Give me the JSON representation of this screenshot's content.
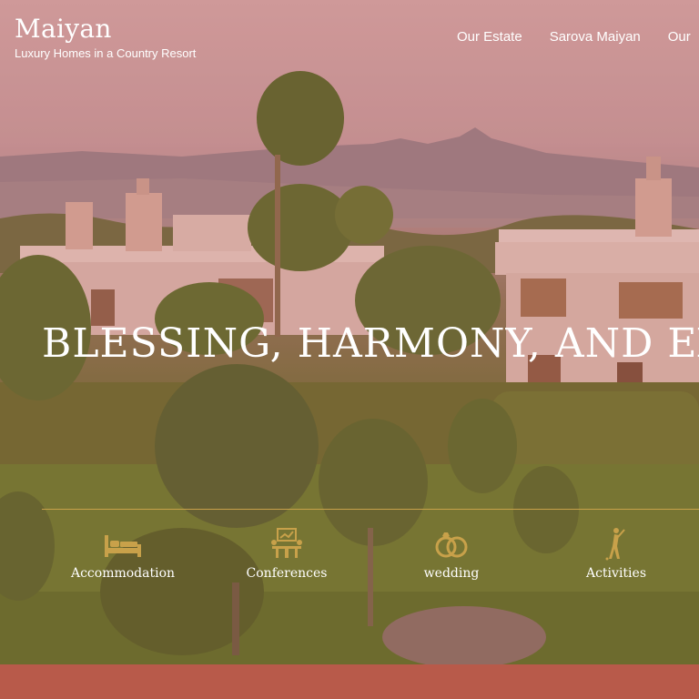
{
  "brand": {
    "title": "Maiyan",
    "tagline": "Luxury Homes in a Country Resort"
  },
  "nav": {
    "items": [
      "Our Estate",
      "Sarova Maiyan",
      "Our"
    ]
  },
  "hero": {
    "headline": "BLESSING, HARMONY, AND EX"
  },
  "features": [
    {
      "label": "Accommodation",
      "icon": "bed-icon"
    },
    {
      "label": "Conferences",
      "icon": "conference-icon"
    },
    {
      "label": "wedding",
      "icon": "wedding-rings-icon"
    },
    {
      "label": "Activities",
      "icon": "golfer-icon"
    }
  ],
  "colors": {
    "accent_gold": "#c8a14a",
    "footer_bar": "#b85a4a",
    "overlay_tint": "#b25c5c"
  }
}
